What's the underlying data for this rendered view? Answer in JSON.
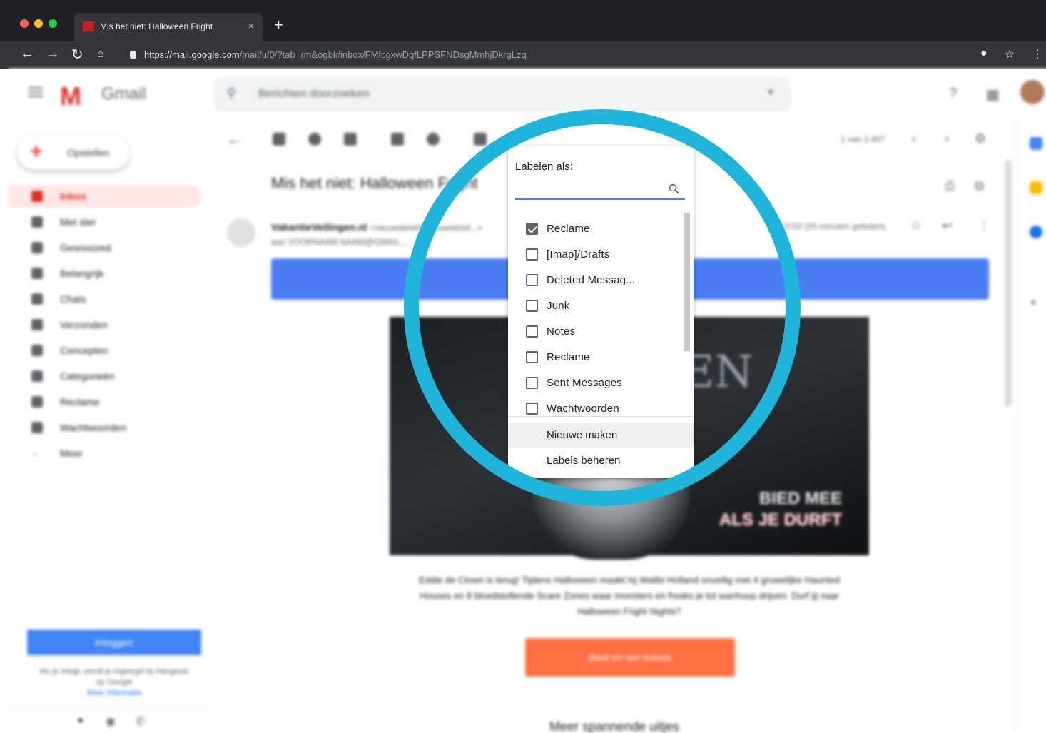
{
  "browser": {
    "tab_title": "Mis het niet: Halloween Fright",
    "tab_close": "×",
    "new_tab": "+",
    "url_host": "https://mail.google.com",
    "url_path": "/mail/u/0/?tab=rm&ogbl#inbox/FMfcgxwDqfLPPSFNDsgMmhjDkrgLzq"
  },
  "gmail": {
    "app_name": "Gmail",
    "search_placeholder": "Berichten doorzoeken",
    "compose_label": "Opstellen",
    "sidebar": [
      {
        "label": "Inbox",
        "active": true
      },
      {
        "label": "Met ster"
      },
      {
        "label": "Gesnoozed"
      },
      {
        "label": "Belangrijk"
      },
      {
        "label": "Chats"
      },
      {
        "label": "Verzonden"
      },
      {
        "label": "Concepten"
      },
      {
        "label": "Categorieën"
      },
      {
        "label": "Reclame"
      },
      {
        "label": "Wachtwoorden"
      },
      {
        "label": "Meer"
      }
    ],
    "login_button": "Inloggen",
    "login_note": "Als je inlogt, wordt je ingelogd bij Hangouts op Google",
    "login_link": "Meer informatie",
    "page_count": "1 van 1.407",
    "subject": "Mis het niet: Halloween Fright",
    "sender_name": "VakantieVeilingen.nl",
    "sender_addr": "<nieuwsbrief@nieuwsbrief...>",
    "recipient": "aan VOORNAAM.NAAM@GMAIL...",
    "timestamp": "12:02 (20 minuten geleden)",
    "hero_ghost_text": "EN",
    "hero_tag_line1": "BIED MEE",
    "hero_tag_line2": "ALS JE DURFT",
    "email_body": "Eddie de Clown is terug! Tijdens Halloween maakt hij Walibi Holland onveilig met 4 gruwelijke Haunted Houses en 8 bloedstollende Scare Zones waar monsters en freaks je tot wanhoop drijven. Durf jij naar Halloween Fright Nights?",
    "cta_label": "Bied en win tickets",
    "more_title": "Meer spannende uitjes"
  },
  "label_popup": {
    "title": "Labelen als:",
    "search_value": "",
    "items": [
      {
        "label": "Reclame",
        "checked": true
      },
      {
        "label": "[Imap]/Drafts",
        "checked": false
      },
      {
        "label": "Deleted Messag...",
        "checked": false
      },
      {
        "label": "Junk",
        "checked": false
      },
      {
        "label": "Notes",
        "checked": false
      },
      {
        "label": "Reclame",
        "checked": false
      },
      {
        "label": "Sent Messages",
        "checked": false
      },
      {
        "label": "Wachtwoorden",
        "checked": false
      }
    ],
    "create_new": "Nieuwe maken",
    "manage_labels": "Labels beheren"
  },
  "colors": {
    "highlight_ring": "#1fb5db",
    "gmail_red": "#d93025",
    "blue": "#4a7cf4",
    "cta_orange": "#ff7043"
  }
}
